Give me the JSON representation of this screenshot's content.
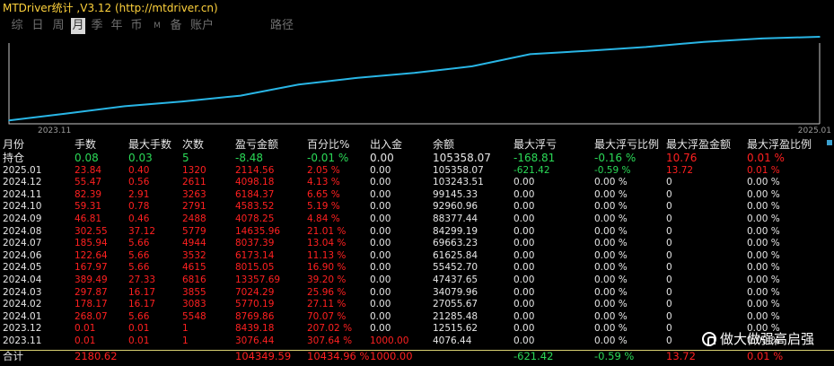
{
  "title": "MTDriver统计 ,V3.12 (http://mtdriver.cn)",
  "toolbar": {
    "items": [
      {
        "label": "综",
        "active": false
      },
      {
        "label": "日",
        "active": false
      },
      {
        "label": "周",
        "active": false
      },
      {
        "label": "月",
        "active": true
      },
      {
        "label": "季",
        "active": false
      },
      {
        "label": "年",
        "active": false
      },
      {
        "label": "币",
        "active": false
      },
      {
        "label": "M",
        "active": false
      },
      {
        "label": "备",
        "active": false
      },
      {
        "label": "账户",
        "active": false
      }
    ],
    "path_label": "路径"
  },
  "chart_data": {
    "type": "line",
    "x": [
      "2023.11",
      "2023.12",
      "2024.01",
      "2024.02",
      "2024.03",
      "2024.04",
      "2024.05",
      "2024.06",
      "2024.07",
      "2024.08",
      "2024.09",
      "2024.10",
      "2024.11",
      "2024.12",
      "2025.01"
    ],
    "values": [
      4076.44,
      12515.62,
      21285.48,
      27055.67,
      34079.96,
      47437.65,
      55452.7,
      61625.84,
      69663.23,
      84299.19,
      88377.44,
      92960.96,
      99145.33,
      103243.51,
      105358.07
    ],
    "x_start_label": "2023.11",
    "x_end_label": "2025.01",
    "line_color": "#29b6e6",
    "axis_color": "#c8c8c8"
  },
  "table": {
    "headers": [
      "月份",
      "手数",
      "最大手数",
      "次数",
      "盈亏金额",
      "百分比%",
      "出入金",
      "余额",
      "最大浮亏",
      "最大浮亏比例",
      "最大浮盈金额",
      "最大浮盈比例"
    ],
    "rows": [
      {
        "cells": [
          "持仓",
          "0.08",
          "0.03",
          "5",
          "-8.48",
          "-0.01 %",
          "0.00",
          "105358.07",
          "-168.81",
          "-0.16 %",
          "10.76",
          "0.01 %"
        ],
        "colors": [
          "white",
          "green",
          "green",
          "green",
          "green",
          "green",
          "white",
          "white",
          "green",
          "green",
          "red",
          "red"
        ]
      },
      {
        "cells": [
          "2025.01",
          "23.84",
          "0.40",
          "1320",
          "2114.56",
          "2.05 %",
          "0.00",
          "105358.07",
          "-621.42",
          "-0.59 %",
          "13.72",
          "0.01 %"
        ],
        "colors": [
          "white",
          "red",
          "red",
          "red",
          "red",
          "red",
          "white",
          "white",
          "green",
          "green",
          "red",
          "red"
        ]
      },
      {
        "cells": [
          "2024.12",
          "55.47",
          "0.56",
          "2611",
          "4098.18",
          "4.13 %",
          "0.00",
          "103243.51",
          "0.00",
          "0.00 %",
          "0",
          "0.00 %"
        ],
        "colors": [
          "white",
          "red",
          "red",
          "red",
          "red",
          "red",
          "white",
          "white",
          "white",
          "white",
          "white",
          "white"
        ]
      },
      {
        "cells": [
          "2024.11",
          "82.39",
          "2.91",
          "3263",
          "6184.37",
          "6.65 %",
          "0.00",
          "99145.33",
          "0.00",
          "0.00 %",
          "0",
          "0.00 %"
        ],
        "colors": [
          "white",
          "red",
          "red",
          "red",
          "red",
          "red",
          "white",
          "white",
          "white",
          "white",
          "white",
          "white"
        ]
      },
      {
        "cells": [
          "2024.10",
          "59.31",
          "0.78",
          "2791",
          "4583.52",
          "5.19 %",
          "0.00",
          "92960.96",
          "0.00",
          "0.00 %",
          "0",
          "0.00 %"
        ],
        "colors": [
          "white",
          "red",
          "red",
          "red",
          "red",
          "red",
          "white",
          "white",
          "white",
          "white",
          "white",
          "white"
        ]
      },
      {
        "cells": [
          "2024.09",
          "46.81",
          "0.46",
          "2488",
          "4078.25",
          "4.84 %",
          "0.00",
          "88377.44",
          "0.00",
          "0.00 %",
          "0",
          "0.00 %"
        ],
        "colors": [
          "white",
          "red",
          "red",
          "red",
          "red",
          "red",
          "white",
          "white",
          "white",
          "white",
          "white",
          "white"
        ]
      },
      {
        "cells": [
          "2024.08",
          "302.55",
          "37.12",
          "5779",
          "14635.96",
          "21.01 %",
          "0.00",
          "84299.19",
          "0.00",
          "0.00 %",
          "0",
          "0.00 %"
        ],
        "colors": [
          "white",
          "red",
          "red",
          "red",
          "red",
          "red",
          "white",
          "white",
          "white",
          "white",
          "white",
          "white"
        ]
      },
      {
        "cells": [
          "2024.07",
          "185.94",
          "5.66",
          "4944",
          "8037.39",
          "13.04 %",
          "0.00",
          "69663.23",
          "0.00",
          "0.00 %",
          "0",
          "0.00 %"
        ],
        "colors": [
          "white",
          "red",
          "red",
          "red",
          "red",
          "red",
          "white",
          "white",
          "white",
          "white",
          "white",
          "white"
        ]
      },
      {
        "cells": [
          "2024.06",
          "122.64",
          "5.66",
          "3532",
          "6173.14",
          "11.13 %",
          "0.00",
          "61625.84",
          "0.00",
          "0.00 %",
          "0",
          "0.00 %"
        ],
        "colors": [
          "white",
          "red",
          "red",
          "red",
          "red",
          "red",
          "white",
          "white",
          "white",
          "white",
          "white",
          "white"
        ]
      },
      {
        "cells": [
          "2024.05",
          "167.97",
          "5.66",
          "4615",
          "8015.05",
          "16.90 %",
          "0.00",
          "55452.70",
          "0.00",
          "0.00 %",
          "0",
          "0.00 %"
        ],
        "colors": [
          "white",
          "red",
          "red",
          "red",
          "red",
          "red",
          "white",
          "white",
          "white",
          "white",
          "white",
          "white"
        ]
      },
      {
        "cells": [
          "2024.04",
          "389.49",
          "27.33",
          "6816",
          "13357.69",
          "39.20 %",
          "0.00",
          "47437.65",
          "0.00",
          "0.00 %",
          "0",
          "0.00 %"
        ],
        "colors": [
          "white",
          "red",
          "red",
          "red",
          "red",
          "red",
          "white",
          "white",
          "white",
          "white",
          "white",
          "white"
        ]
      },
      {
        "cells": [
          "2024.03",
          "297.87",
          "16.17",
          "3855",
          "7024.29",
          "25.96 %",
          "0.00",
          "34079.96",
          "0.00",
          "0.00 %",
          "0",
          "0.00 %"
        ],
        "colors": [
          "white",
          "red",
          "red",
          "red",
          "red",
          "red",
          "white",
          "white",
          "white",
          "white",
          "white",
          "white"
        ]
      },
      {
        "cells": [
          "2024.02",
          "178.17",
          "16.17",
          "3083",
          "5770.19",
          "27.11 %",
          "0.00",
          "27055.67",
          "0.00",
          "0.00 %",
          "0",
          "0.00 %"
        ],
        "colors": [
          "white",
          "red",
          "red",
          "red",
          "red",
          "red",
          "white",
          "white",
          "white",
          "white",
          "white",
          "white"
        ]
      },
      {
        "cells": [
          "2024.01",
          "268.07",
          "5.66",
          "5548",
          "8769.86",
          "70.07 %",
          "0.00",
          "21285.48",
          "0.00",
          "0.00 %",
          "0",
          "0.00 %"
        ],
        "colors": [
          "white",
          "red",
          "red",
          "red",
          "red",
          "red",
          "white",
          "white",
          "white",
          "white",
          "white",
          "white"
        ]
      },
      {
        "cells": [
          "2023.12",
          "0.01",
          "0.01",
          "1",
          "8439.18",
          "207.02 %",
          "0.00",
          "12515.62",
          "0.00",
          "0.00 %",
          "0",
          "0.00 %"
        ],
        "colors": [
          "white",
          "red",
          "red",
          "red",
          "red",
          "red",
          "white",
          "white",
          "white",
          "white",
          "white",
          "white"
        ]
      },
      {
        "cells": [
          "2023.11",
          "0.01",
          "0.01",
          "1",
          "3076.44",
          "307.64 %",
          "1000.00",
          "4076.44",
          "0.00",
          "0.00 %",
          "0",
          "0.00 %"
        ],
        "colors": [
          "white",
          "red",
          "red",
          "red",
          "red",
          "red",
          "red",
          "white",
          "white",
          "white",
          "white",
          "white"
        ]
      }
    ],
    "total": {
      "cells": [
        "合计",
        "2180.62",
        "",
        "",
        "104349.59",
        "10434.96 %",
        "1000.00",
        "",
        "-621.42",
        "-0.59 %",
        "13.72",
        "0.01 %"
      ],
      "colors": [
        "white",
        "red",
        "red",
        "red",
        "red",
        "red",
        "red",
        "white",
        "green",
        "green",
        "red",
        "red"
      ]
    }
  },
  "watermark": {
    "text": "做大做强高启强"
  }
}
